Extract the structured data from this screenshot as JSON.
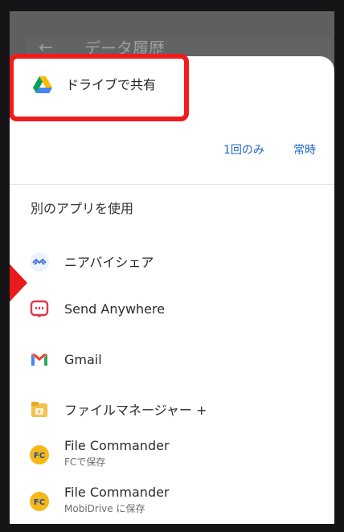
{
  "background": {
    "title": "データ履歴"
  },
  "share_sheet": {
    "primary": {
      "label": "ドライブで共有"
    },
    "once_label": "1回のみ",
    "always_label": "常時",
    "section_title": "別のアプリを使用",
    "apps": [
      {
        "name": "ニアバイシェア",
        "subtitle": "",
        "icon": "nearby-share-icon"
      },
      {
        "name": "Send Anywhere",
        "subtitle": "",
        "icon": "send-anywhere-icon"
      },
      {
        "name": "Gmail",
        "subtitle": "",
        "icon": "gmail-icon"
      },
      {
        "name": "ファイルマネージャー +",
        "subtitle": "",
        "icon": "file-manager-icon"
      },
      {
        "name": "File Commander",
        "subtitle": "FCで保存",
        "icon": "file-commander-icon"
      },
      {
        "name": "File Commander",
        "subtitle": "MobiDrive に保存",
        "icon": "file-commander-icon"
      }
    ]
  },
  "colors": {
    "accent": "#1e65c8",
    "highlight": "#ee1c1c"
  }
}
